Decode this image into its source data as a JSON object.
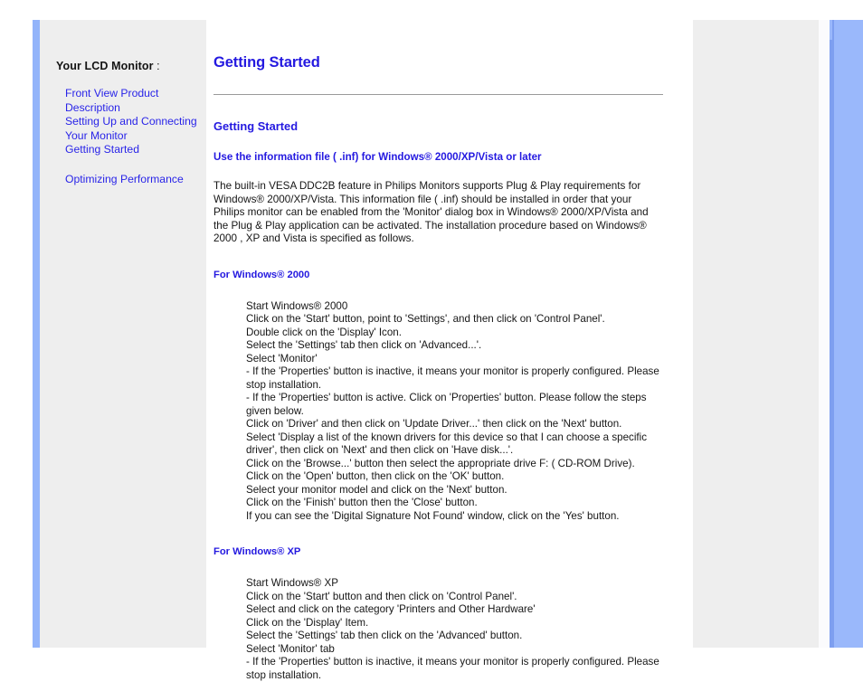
{
  "sidebar": {
    "title": "Your LCD Monitor",
    "title_colon": " :",
    "links": [
      {
        "label": "Front View Product"
      },
      {
        "label": "Description"
      },
      {
        "label": "Setting Up and Connecting"
      },
      {
        "label": "Your Monitor"
      },
      {
        "label": "Getting Started"
      }
    ],
    "links_after_gap": [
      {
        "label": "Optimizing Performance"
      }
    ]
  },
  "content": {
    "page_title": "Getting Started",
    "section_title": "Getting Started",
    "sub_title": "Use the information file ( .inf) for Windows® 2000/XP/Vista or later",
    "intro_paragraph": "The built-in VESA DDC2B feature in Philips Monitors supports Plug & Play requirements for Windows® 2000/XP/Vista. This information file ( .inf) should be installed in order that your Philips monitor can be enabled from the 'Monitor' dialog box in Windows® 2000/XP/Vista and the Plug & Play application can be activated. The installation procedure based on Windows® 2000 , XP and Vista is specified as follows.",
    "win2000": {
      "heading": "For Windows® 2000",
      "steps": [
        "Start Windows® 2000",
        "Click on the 'Start' button, point to 'Settings', and then click on 'Control Panel'.",
        "Double click on the 'Display' Icon.",
        "Select the 'Settings' tab then click on 'Advanced...'.",
        "Select 'Monitor'",
        "- If the 'Properties' button is inactive, it means your monitor is properly configured. Please stop installation.",
        "- If the 'Properties' button is active. Click on 'Properties' button. Please follow the steps given below.",
        "Click on 'Driver' and then click on 'Update Driver...' then click on the 'Next' button.",
        "Select 'Display a list of the known drivers for this device so that I can choose a specific driver', then click on 'Next' and then click on 'Have disk...'.",
        "Click on the 'Browse...' button then select the appropriate drive F: ( CD-ROM Drive).",
        "Click on the 'Open' button, then click on the 'OK' button.",
        "Select your monitor model and click on the 'Next' button.",
        "Click on the 'Finish' button then the 'Close' button.",
        "If you can see the 'Digital Signature Not Found' window, click on the 'Yes' button."
      ]
    },
    "winxp": {
      "heading": "For Windows® XP",
      "steps": [
        "Start Windows® XP",
        "Click on the 'Start' button and then click on 'Control Panel'.",
        "Select and click on the category 'Printers and Other Hardware'",
        "Click on the 'Display' Item.",
        "Select the 'Settings' tab then click on the 'Advanced' button.",
        "Select 'Monitor' tab",
        "- If the 'Properties' button is inactive, it means your monitor is properly configured. Please stop installation."
      ]
    }
  },
  "colors": {
    "link_blue": "#2924e8",
    "heading_blue": "#2419e0",
    "accent_bar": "#93b4fa",
    "panel_gray": "#eeeeee",
    "right_blue": "#9ab8fb",
    "rule_gray": "#9a9a9a",
    "body_text": "#161616"
  }
}
